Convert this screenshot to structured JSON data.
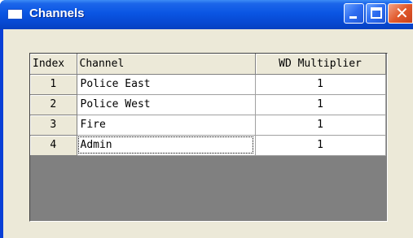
{
  "window": {
    "title": "Channels",
    "icon": "window-app-icon",
    "controls": {
      "minimize": "minimize",
      "maximize": "maximize",
      "close": "close"
    }
  },
  "grid": {
    "columns": [
      "Index",
      "Channel",
      "WD Multiplier"
    ],
    "rows": [
      {
        "index": "1",
        "channel": "Police East",
        "wd_multiplier": "1"
      },
      {
        "index": "2",
        "channel": "Police West",
        "wd_multiplier": "1"
      },
      {
        "index": "3",
        "channel": "Fire",
        "wd_multiplier": "1"
      },
      {
        "index": "4",
        "channel": "Admin",
        "wd_multiplier": "1"
      }
    ],
    "focused_cell": "Admin"
  },
  "colors": {
    "titlebar": "#0a55e3",
    "client_background": "#ece9d8",
    "grid_background": "#808080",
    "cell_background": "#ffffff"
  }
}
